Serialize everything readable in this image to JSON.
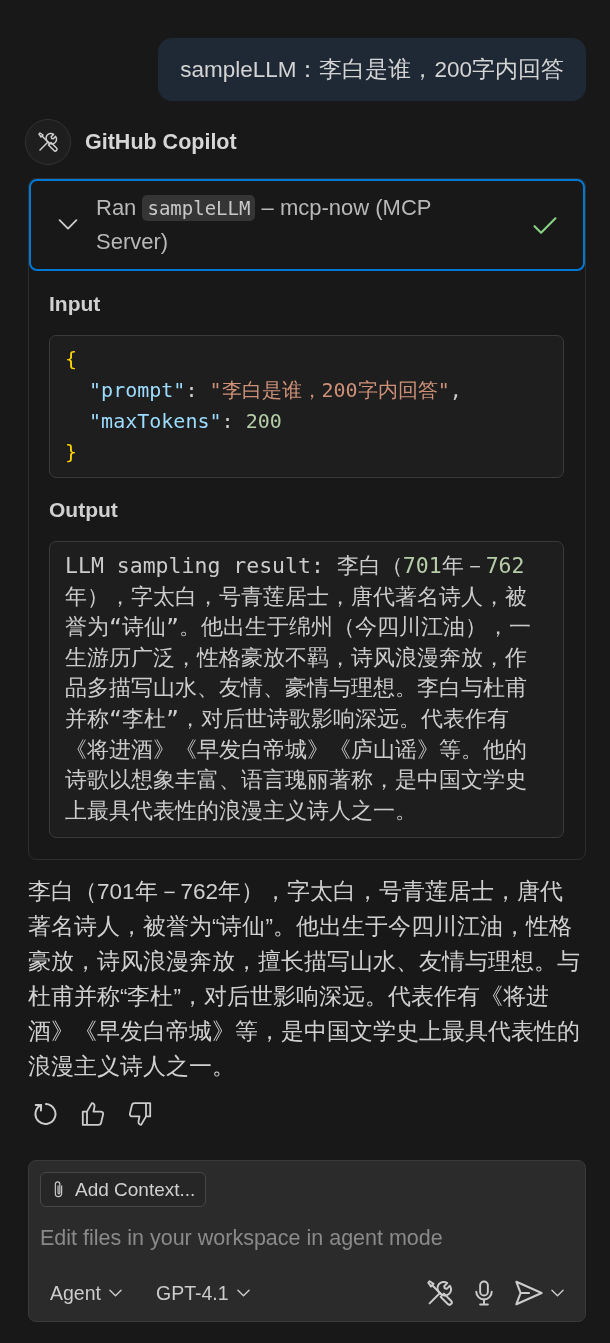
{
  "user_message": {
    "text": "sampleLLM：李白是谁，200字内回答"
  },
  "assistant": {
    "name": "GitHub Copilot"
  },
  "tool_call": {
    "expanded": true,
    "focused": true,
    "completed": true,
    "title": [
      {
        "kind": "text",
        "text": "Ran"
      },
      {
        "kind": "code",
        "text": "sampleLLM"
      },
      {
        "kind": "text",
        "text": "– mcp-now (MCP Server)"
      }
    ],
    "input_label": "Input",
    "input_code": [
      {
        "tokens": [
          {
            "kind": "brace",
            "text": "{"
          }
        ],
        "children": [
          {
            "tokens": [
              {
                "kind": "key",
                "text": "\"prompt\""
              },
              {
                "kind": "punctuation",
                "text": ":"
              },
              {
                "kind": "string",
                "text": "\"李白是谁，200字内回答\""
              },
              {
                "kind": "punctuation",
                "text": ","
              }
            ]
          },
          {
            "tokens": [
              {
                "kind": "key",
                "text": "\"maxTokens\""
              },
              {
                "kind": "punctuation",
                "text": ":"
              },
              {
                "kind": "number",
                "text": "200"
              }
            ]
          }
        ]
      },
      {
        "tokens": [
          {
            "kind": "brace",
            "text": "}"
          }
        ]
      }
    ],
    "output_label": "Output",
    "output": [
      {
        "kind": "text",
        "text": "LLM sampling result: 李白（"
      },
      {
        "kind": "number",
        "text": "701"
      },
      {
        "kind": "text",
        "text": "年－"
      },
      {
        "kind": "number",
        "text": "762"
      },
      {
        "kind": "text",
        "text": "年），字太白，号青莲居士，唐代著名诗人，被誉为“诗仙”。他出生于绵州（今四川江油），一生游历广泛，性格豪放不羁，诗风浪漫奔放，作品多描写山水、友情、豪情与理想。李白与杜甫并称“李杜”，对后世诗歌影响深远。代表作有《将进酒》《早发白帝城》《庐山谣》等。他的诗歌以想象丰富、语言瑰丽著称，是中国文学史上最具代表性的浪漫主义诗人之一。"
      }
    ]
  },
  "response": {
    "text": "李白（701年－762年），字太白，号青莲居士，唐代著名诗人，被誉为“诗仙”。他出生于今四川江油，性格豪放，诗风浪漫奔放，擅长描写山水、友情与理想。与杜甫并称“李杜”，对后世影响深远。代表作有《将进酒》《早发白帝城》等，是中国文学史上最具代表性的浪漫主义诗人之一。"
  },
  "chat_input": {
    "add_context_label": "Add Context...",
    "placeholder": "Edit files in your workspace in agent mode",
    "mode": "Agent",
    "model": "GPT-4.1"
  }
}
